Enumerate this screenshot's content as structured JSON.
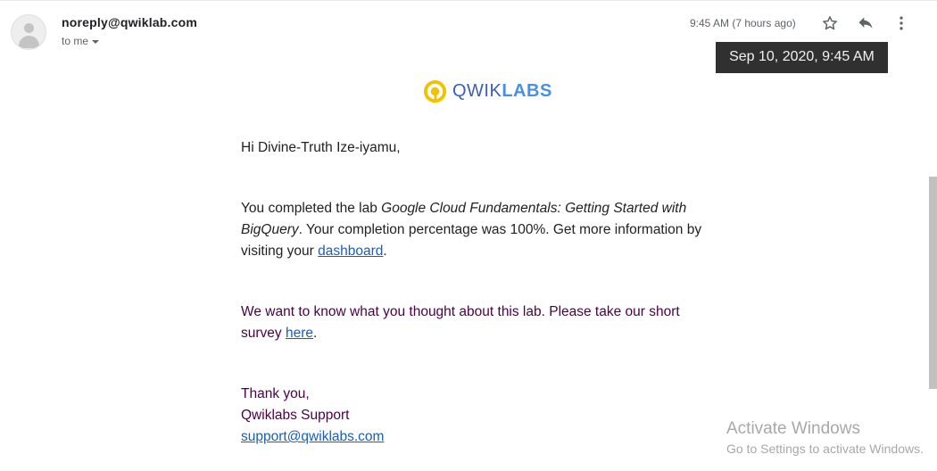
{
  "header": {
    "sender": "noreply@qwiklab.com",
    "to_label": "to me",
    "time": "9:45 AM (7 hours ago)",
    "tooltip": "Sep 10, 2020, 9:45 AM"
  },
  "icons": {
    "avatar": "person-icon",
    "star": "star-icon",
    "reply": "reply-icon",
    "more": "more-vert-icon",
    "logo": "qwiklabs-logo-icon"
  },
  "logo": {
    "part1": "QWIK",
    "part2": "LABS"
  },
  "email": {
    "greeting": "Hi Divine-Truth Ize-iyamu,",
    "p1_a": "You completed the lab ",
    "p1_lab": "Google Cloud Fundamentals: Getting Started with BigQuery",
    "p1_b": ". Your completion percentage was 100%. Get more information by visiting your ",
    "p1_link": "dashboard",
    "p1_end": ".",
    "p2_a": "We want to know what you thought about this lab. Please take our short survey ",
    "p2_link": "here",
    "p2_end": ".",
    "sign_thanks": "Thank you,",
    "sign_name": "Qwiklabs Support",
    "sign_email": "support@qwiklabs.com"
  },
  "watermark": {
    "line1": "Activate Windows",
    "line2": "Go to Settings to activate Windows."
  },
  "colors": {
    "link": "#1a5fb4",
    "purple_text": "#4b0046",
    "logo_yellow": "#f2c200",
    "tooltip_bg": "#303030"
  }
}
